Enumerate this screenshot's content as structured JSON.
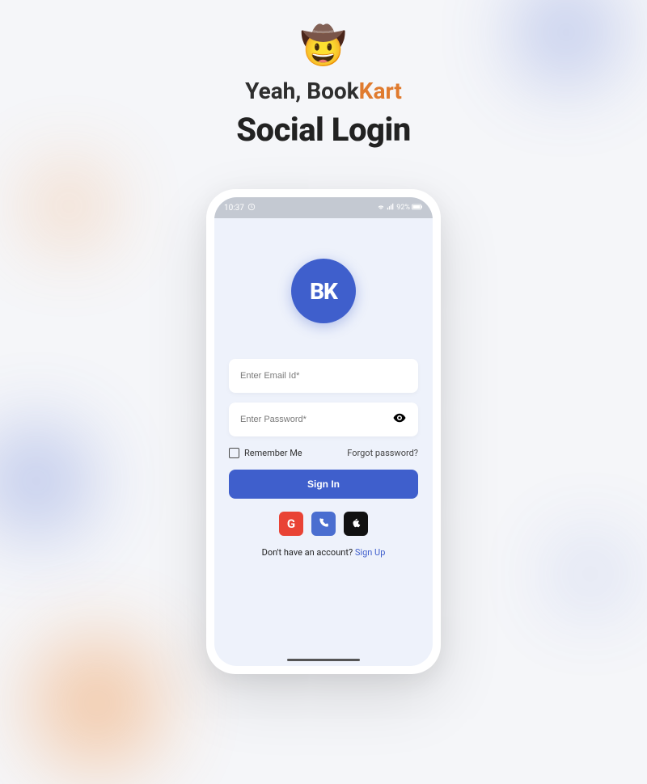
{
  "hero": {
    "emoji": "🤠",
    "brand_prefix": "Yeah, Book",
    "brand_accent": "Kart",
    "title": "Social Login"
  },
  "statusbar": {
    "time": "10:37",
    "battery": "92%"
  },
  "logo": {
    "text": "BK"
  },
  "form": {
    "email_placeholder": "Enter Email Id*",
    "password_placeholder": "Enter Password*",
    "remember_label": "Remember Me",
    "forgot_label": "Forgot password?",
    "signin_label": "Sign In",
    "no_account_text": "Don't have an account? ",
    "signup_label": "Sign Up"
  },
  "social": {
    "google": "G",
    "phone": "phone",
    "apple": "apple"
  }
}
